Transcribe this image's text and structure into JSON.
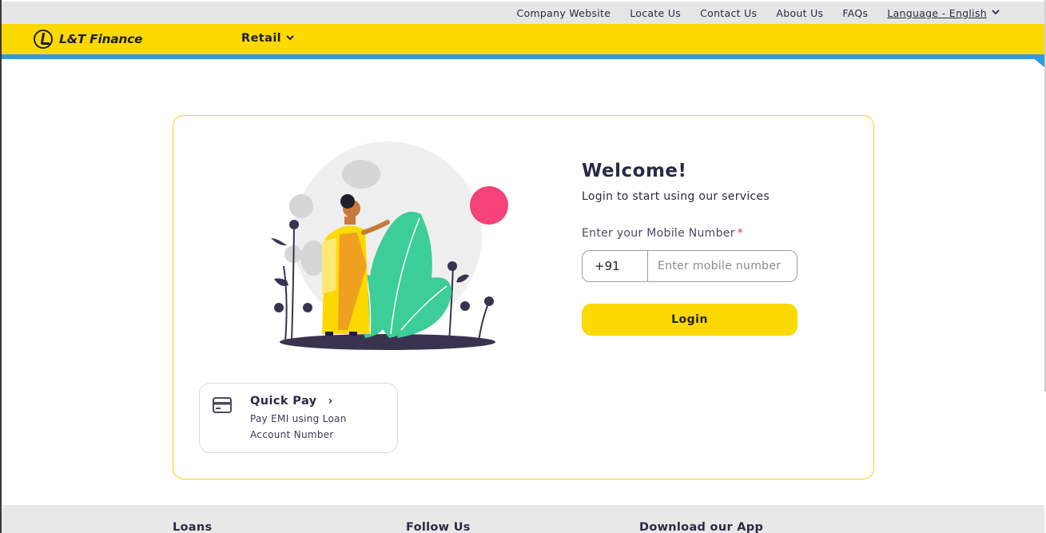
{
  "header": {
    "links": [
      {
        "label": "Company Website"
      },
      {
        "label": "Locate Us"
      },
      {
        "label": "Contact Us"
      },
      {
        "label": "About Us"
      },
      {
        "label": "FAQs"
      }
    ],
    "language": "Language - English"
  },
  "nav": {
    "logo_text": "L&T Finance",
    "menu_label": "Retail"
  },
  "login": {
    "title": "Welcome!",
    "subtitle": "Login to start using our services",
    "mobile_label": "Enter your Mobile Number",
    "required_mark": "*",
    "country_code": "+91",
    "mobile_placeholder": "Enter mobile number",
    "mobile_value": "",
    "button_label": "Login"
  },
  "quick_pay": {
    "title": "Quick Pay",
    "arrow": "›",
    "description": "Pay EMI using Loan Account Number",
    "icon": "card-icon"
  },
  "footer": {
    "columns": [
      "Loans",
      "Follow Us",
      "Download our App"
    ]
  },
  "colors": {
    "brand_yellow": "#fcd900",
    "accent_blue": "#2f9ae0",
    "required_red": "#e53935",
    "pink_dot": "#f4437a",
    "leaf_green": "#3dcd98"
  }
}
